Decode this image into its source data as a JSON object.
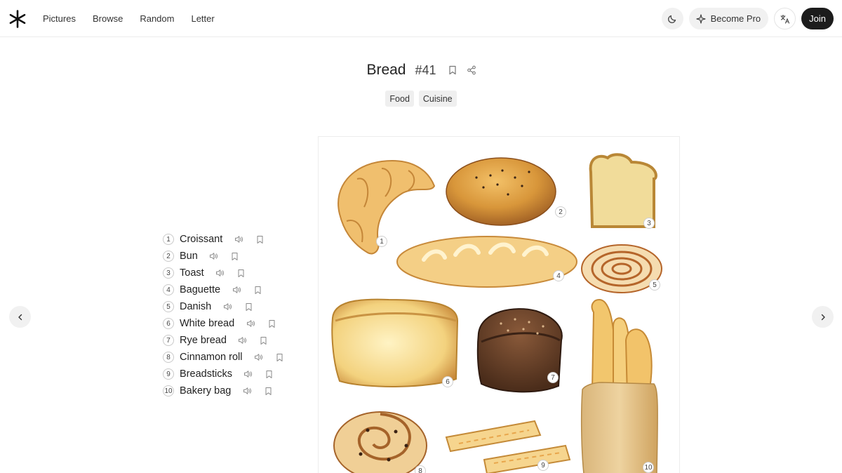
{
  "nav": {
    "items": [
      "Pictures",
      "Browse",
      "Random",
      "Letter"
    ],
    "become_pro_label": "Become Pro",
    "join_label": "Join"
  },
  "page": {
    "title": "Bread",
    "number": "#41",
    "tags": [
      "Food",
      "Cuisine"
    ]
  },
  "words": [
    {
      "num": "1",
      "label": "Croissant"
    },
    {
      "num": "2",
      "label": "Bun"
    },
    {
      "num": "3",
      "label": "Toast"
    },
    {
      "num": "4",
      "label": "Baguette"
    },
    {
      "num": "5",
      "label": "Danish"
    },
    {
      "num": "6",
      "label": "White bread"
    },
    {
      "num": "7",
      "label": "Rye bread"
    },
    {
      "num": "8",
      "label": "Cinnamon roll"
    },
    {
      "num": "9",
      "label": "Breadsticks"
    },
    {
      "num": "10",
      "label": "Bakery bag"
    }
  ],
  "illustration_labels": [
    "1",
    "2",
    "3",
    "4",
    "5",
    "6",
    "7",
    "8",
    "9",
    "10"
  ],
  "colors": {
    "accent_dark": "#1c1c1c",
    "pill_bg": "#f1f1f1",
    "bread_golden": "#e8b56a",
    "bread_dark": "#5a3a25"
  },
  "icons": {
    "logo": "asterisk-logo-icon",
    "theme": "moon-icon",
    "pro": "sparkle-icon",
    "language": "translate-icon",
    "bookmark": "bookmark-icon",
    "share": "share-icon",
    "audio": "speaker-icon",
    "prev": "chevron-left-icon",
    "next": "chevron-right-icon"
  }
}
